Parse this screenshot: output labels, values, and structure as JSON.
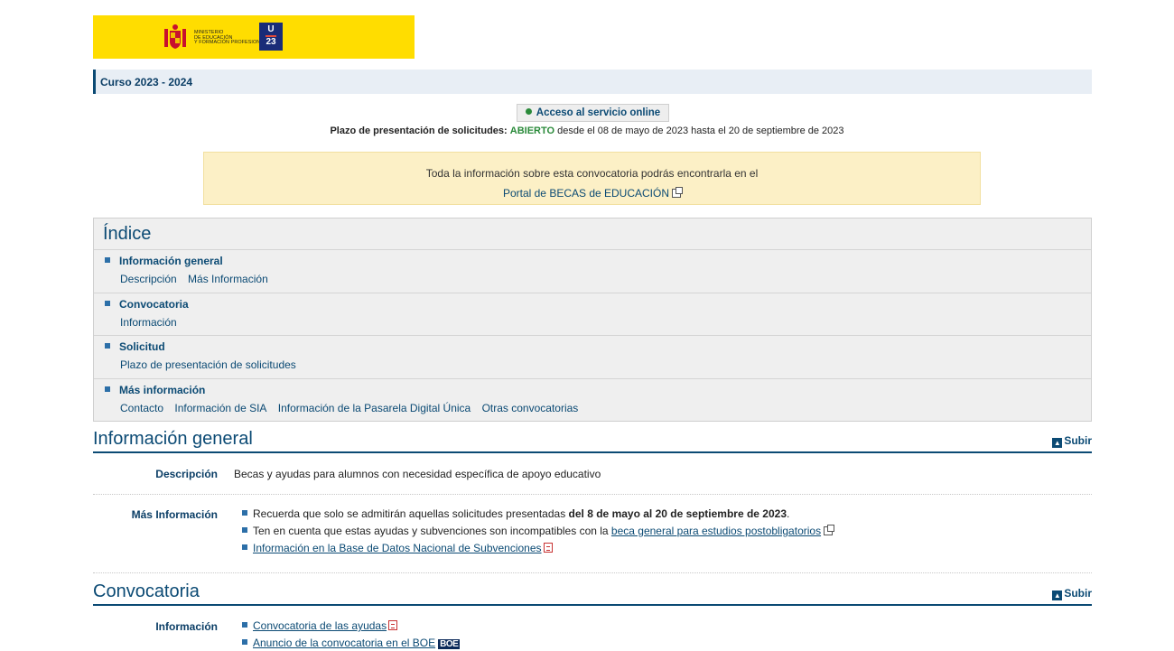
{
  "header": {
    "ministry_lines": [
      "MINISTERIO",
      "DE EDUCACIÓN",
      "Y FORMACIÓN PROFESIONAL"
    ],
    "badge_top": "U",
    "badge_bottom": "23",
    "colors": {
      "band": "#ffdd00",
      "badge": "#1a2c78"
    }
  },
  "curso": {
    "label": "Curso 2023 - 2024"
  },
  "acceso": {
    "label": "Acceso al servicio online",
    "status_color": "#2a8a3a"
  },
  "plazo": {
    "label": "Plazo de presentación de solicitudes:",
    "status": "ABIERTO",
    "range": "desde el 08 de mayo de 2023 hasta el 20 de septiembre de 2023"
  },
  "notice": {
    "text": "Toda la información sobre esta convocatoria podrás encontrarla en el",
    "link": "Portal de BECAS de EDUCACIÓN"
  },
  "indice": {
    "title": "Índice",
    "sections": [
      {
        "title": "Información general",
        "links": [
          "Descripción",
          "Más Información"
        ]
      },
      {
        "title": "Convocatoria",
        "links": [
          "Información"
        ]
      },
      {
        "title": "Solicitud",
        "links": [
          "Plazo de presentación de solicitudes"
        ]
      },
      {
        "title": "Más información",
        "links": [
          "Contacto",
          "Información de SIA",
          "Información de la Pasarela Digital Única",
          "Otras convocatorias"
        ]
      }
    ]
  },
  "subir_label": "Subir",
  "info_general": {
    "title": "Información general",
    "descripcion_label": "Descripción",
    "descripcion_text": "Becas y ayudas para alumnos con necesidad específica de apoyo educativo",
    "mas_info_label": "Más Información",
    "item1_pre": "Recuerda que solo se admitirán aquellas solicitudes presentadas ",
    "item1_bold": "del 8 de mayo al 20 de septiembre de 2023",
    "item1_post": ".",
    "item2_pre": "Ten en cuenta que estas ayudas y subvenciones son incompatibles con la ",
    "item2_link": "beca general para estudios postobligatorios",
    "item3_link": "Información en la Base de Datos Nacional de Subvenciones"
  },
  "convocatoria": {
    "title": "Convocatoria",
    "info_label": "Información",
    "item1_link": "Convocatoria de las ayudas",
    "item2_link": "Anuncio de la convocatoria en el BOE",
    "boe_label": "BOE"
  }
}
